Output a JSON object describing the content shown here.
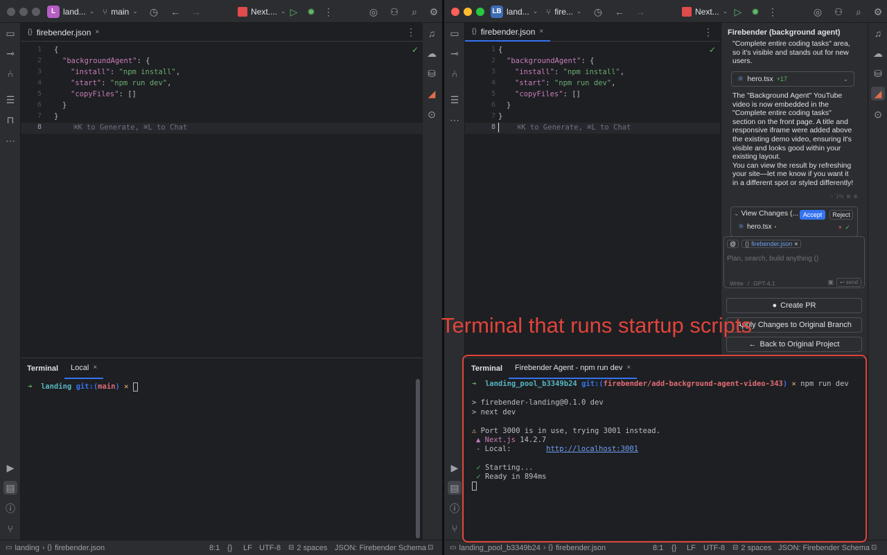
{
  "left": {
    "project_badge": "L",
    "project_name": "land...",
    "branch": "main",
    "run_config": "Next....",
    "tab_file": "firebender.json",
    "terminal_title": "Terminal",
    "terminal_tab": "Local",
    "prompt_dir": "landing",
    "prompt_git": "git:(",
    "prompt_branch": "main",
    "prompt_close": ")",
    "prompt_x": "✕",
    "status_project": "landing",
    "status_file": "firebender.json",
    "status_pos": "8:1",
    "status_braces": "{}",
    "status_lf": "LF",
    "status_enc": "UTF-8",
    "status_indent": "2 spaces",
    "status_schema": "JSON: Firebender Schema"
  },
  "right": {
    "project_badge": "LB",
    "project_name": "land...",
    "branch": "fire...",
    "run_config": "Next...",
    "tab_file": "firebender.json",
    "terminal_title": "Terminal",
    "terminal_tab": "Firebender Agent - npm run dev",
    "status_project": "landing_pool_b3349b24",
    "status_file": "firebender.json",
    "status_pos": "8:1",
    "status_braces": "{}",
    "status_lf": "LF",
    "status_enc": "UTF-8",
    "status_indent": "2 spaces",
    "status_schema": "JSON: Firebender Schema"
  },
  "code": {
    "line_numbers": [
      "1",
      "2",
      "3",
      "4",
      "5",
      "6",
      "7",
      "8"
    ],
    "l1": "{",
    "l2_key": "\"backgroundAgent\"",
    "l2_rest": ": {",
    "l3_key": "\"install\"",
    "l3_val": "\"npm install\"",
    "l4_key": "\"start\"",
    "l4_val": "\"npm run dev\"",
    "l5_key": "\"copyFiles\"",
    "l5_val": ": []",
    "l6": "}",
    "l7": "}",
    "hint": "⌘K to Generate, ⌘L to Chat"
  },
  "terminal_right": {
    "prompt_dir": "landing_pool_b3349b24",
    "prompt_git": "git:(",
    "prompt_branch": "firebender/add-background-agent-video-343",
    "prompt_close": ")",
    "prompt_x": "✕",
    "command": "npm run dev",
    "line1": "> firebender-landing@0.1.0 dev",
    "line2": "> next dev",
    "warn": "Port 3000 is in use, trying 3001 instead.",
    "next_label": "Next.js",
    "next_version": "14.2.7",
    "local_label": "- Local:",
    "local_url": "http://localhost:3001",
    "starting": "Starting...",
    "ready": "Ready in 894ms"
  },
  "agent_panel": {
    "title": "Firebender (background agent)",
    "intro_1": "\"Complete entire coding tasks\" area,",
    "intro_2": "so it's visible and stands out for new",
    "intro_3": "users.",
    "file_chip": "hero.tsx",
    "file_chip_count": "+17",
    "msg_1": "The \"Background Agent\" YouTube",
    "msg_2": "video is now embedded in the",
    "msg_3": "\"Complete entire coding tasks\"",
    "msg_4": "section on the front page. A title and",
    "msg_5": "responsive iframe were added above",
    "msg_6": "the existing demo video, ensuring it's",
    "msg_7": "visible and looks good within your",
    "msg_8": "existing layout.",
    "msg_9": "You can view the result by refreshing",
    "msg_10": "your site—let me know if you want it",
    "msg_11": "in a different spot or styled differently!",
    "meta": "1%",
    "view_changes": "View Changes (...",
    "accept": "Accept",
    "reject": "Reject",
    "changed_file": "hero.tsx",
    "context_chip": "firebender.json",
    "input_placeholder": "Plan, search, build anything ()",
    "mode": "Write",
    "model": "GPT-4.1",
    "send": "send",
    "create_pr": "Create PR",
    "apply_changes": "Apply Changes to Original Branch",
    "back": "Back to Original Project"
  },
  "annotation": "Terminal that runs startup scripts",
  "colors": {
    "accent": "#3574f0",
    "annotation": "#e0443b",
    "string": "#6aab73",
    "key": "#c77dbb",
    "badge_left": "#b55ec4",
    "badge_right": "#3d6db5"
  }
}
